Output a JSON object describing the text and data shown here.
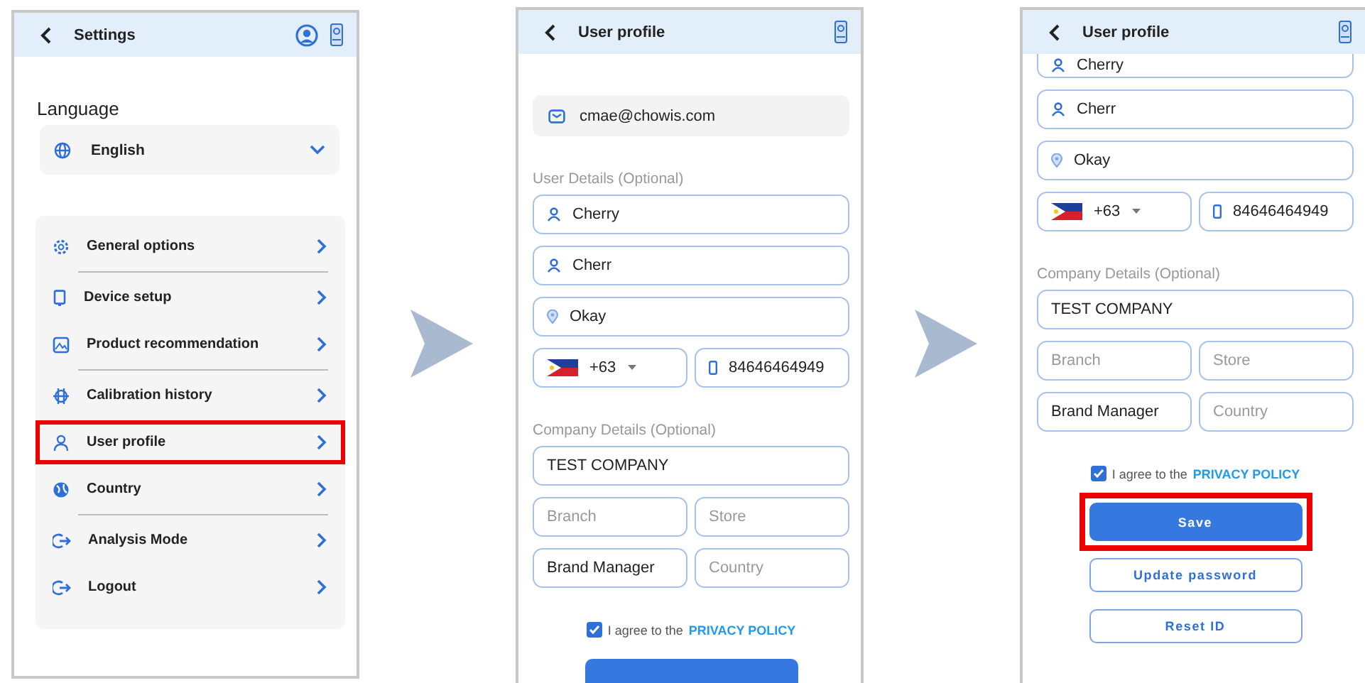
{
  "screens": [
    {
      "kind": "settings",
      "title": "Settings",
      "language_label": "Language",
      "language_value": "English",
      "menu": [
        {
          "label": "General options",
          "highlighted": false,
          "divider_after": true
        },
        {
          "label": "Device setup",
          "highlighted": false,
          "divider_after": false
        },
        {
          "label": "Product recommendation",
          "highlighted": false,
          "divider_after": true
        },
        {
          "label": "Calibration history",
          "highlighted": false,
          "divider_after": false
        },
        {
          "label": "User profile",
          "highlighted": true,
          "divider_after": false
        },
        {
          "label": "Country",
          "highlighted": false,
          "divider_after": true
        },
        {
          "label": "Analysis Mode",
          "highlighted": false,
          "divider_after": false
        },
        {
          "label": "Logout",
          "highlighted": false,
          "divider_after": false
        }
      ]
    },
    {
      "kind": "profile",
      "title": "User profile",
      "rows": [
        {
          "kind": "email",
          "value": "cmae@chowis.com"
        },
        {
          "kind": "label",
          "text": "User Details (Optional)"
        },
        {
          "kind": "person_field",
          "value": "Cherry",
          "cut_top": false
        },
        {
          "kind": "person_field",
          "value": "Cherr",
          "cut_top": false
        },
        {
          "kind": "location_field",
          "value": "Okay"
        },
        {
          "kind": "phone",
          "code": "+63",
          "number": "84646464949"
        },
        {
          "kind": "label",
          "text": "Company Details (Optional)"
        },
        {
          "kind": "text_field",
          "value": "TEST COMPANY"
        },
        {
          "kind": "pair",
          "items": [
            {
              "placeholder": "Branch"
            },
            {
              "placeholder": "Store"
            }
          ]
        },
        {
          "kind": "pair",
          "items": [
            {
              "value": "Brand Manager"
            },
            {
              "placeholder": "Country"
            }
          ]
        },
        {
          "kind": "agree",
          "checked": true,
          "text": "I agree to the",
          "link": "PRIVACY POLICY"
        },
        {
          "kind": "primary_button",
          "highlighted": false
        }
      ]
    },
    {
      "kind": "profile",
      "title": "User profile",
      "rows": [
        {
          "kind": "person_field",
          "value": "Cherry",
          "cut_top": true
        },
        {
          "kind": "person_field",
          "value": "Cherr",
          "cut_top": false
        },
        {
          "kind": "location_field",
          "value": "Okay"
        },
        {
          "kind": "phone",
          "code": "+63",
          "number": "84646464949"
        },
        {
          "kind": "label",
          "text": "Company Details (Optional)"
        },
        {
          "kind": "text_field",
          "value": "TEST COMPANY"
        },
        {
          "kind": "pair",
          "items": [
            {
              "placeholder": "Branch"
            },
            {
              "placeholder": "Store"
            }
          ]
        },
        {
          "kind": "pair",
          "items": [
            {
              "value": "Brand Manager"
            },
            {
              "placeholder": "Country"
            }
          ]
        },
        {
          "kind": "agree",
          "checked": true,
          "text": "I agree to the",
          "link": "PRIVACY POLICY"
        },
        {
          "kind": "primary_button",
          "label": "Save",
          "highlighted": true
        },
        {
          "kind": "outline_button",
          "label": "Update password",
          "highlighted": false
        },
        {
          "kind": "outline_button",
          "label": "Reset ID",
          "highlighted": false
        }
      ]
    }
  ]
}
